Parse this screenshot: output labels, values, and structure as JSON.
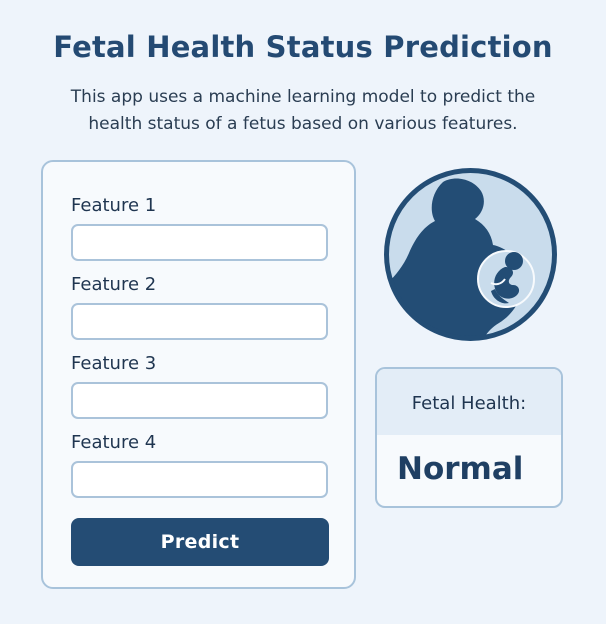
{
  "header": {
    "title": "Fetal Health Status Prediction",
    "subtitle_line1": "This app uses a machine learning model to predict the",
    "subtitle_line2": "health status of a fetus based on various features."
  },
  "form": {
    "fields": [
      {
        "label": "Feature 1",
        "value": "",
        "placeholder": ""
      },
      {
        "label": "Feature 2",
        "value": "",
        "placeholder": ""
      },
      {
        "label": "Feature 3",
        "value": "",
        "placeholder": ""
      },
      {
        "label": "Feature 4",
        "value": "",
        "placeholder": ""
      }
    ],
    "predict_label": "Predict"
  },
  "illustration": {
    "icon": "pregnant-woman-fetus-icon",
    "colors": {
      "dark": "#234d75",
      "light": "#c9dcec",
      "ring": "#234d75"
    }
  },
  "result": {
    "label": "Fetal Health:",
    "value": "Normal"
  },
  "colors": {
    "background": "#eef4fb",
    "accent": "#244c74",
    "border": "#a8c3db"
  }
}
